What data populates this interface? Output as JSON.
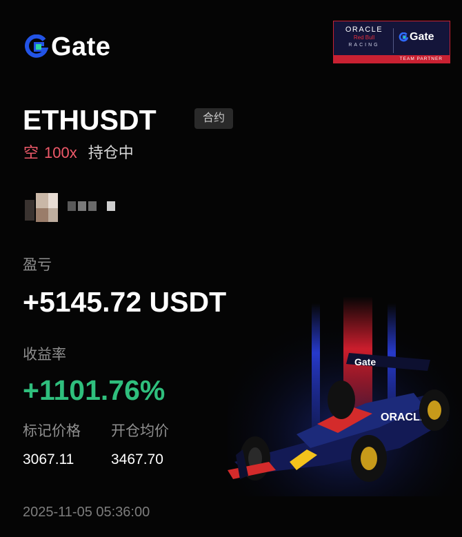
{
  "brand": {
    "logo_text": "Gate",
    "icon": "gate-logo-icon",
    "accent": "#2354e6"
  },
  "partner": {
    "oracle": "ORACLE",
    "redbull": "Red Bull",
    "racing": "RACING",
    "gate": "Gate",
    "footer": "TEAM PARTNER"
  },
  "position": {
    "symbol": "ETHUSDT",
    "contract_tag": "合约",
    "side": "空",
    "leverage": "100x",
    "status": "持仓中"
  },
  "pnl": {
    "label": "盈亏",
    "value": "+5145.72 USDT"
  },
  "roi": {
    "label": "收益率",
    "value": "+1101.76%"
  },
  "prices": {
    "mark_label": "标记价格",
    "mark_value": "3067.11",
    "entry_label": "开仓均价",
    "entry_value": "3467.70"
  },
  "timestamp": "2025-11-05 05:36:00",
  "colors": {
    "short": "#f05a6a",
    "profit": "#2fbf7d",
    "muted": "#8f8f8f"
  }
}
